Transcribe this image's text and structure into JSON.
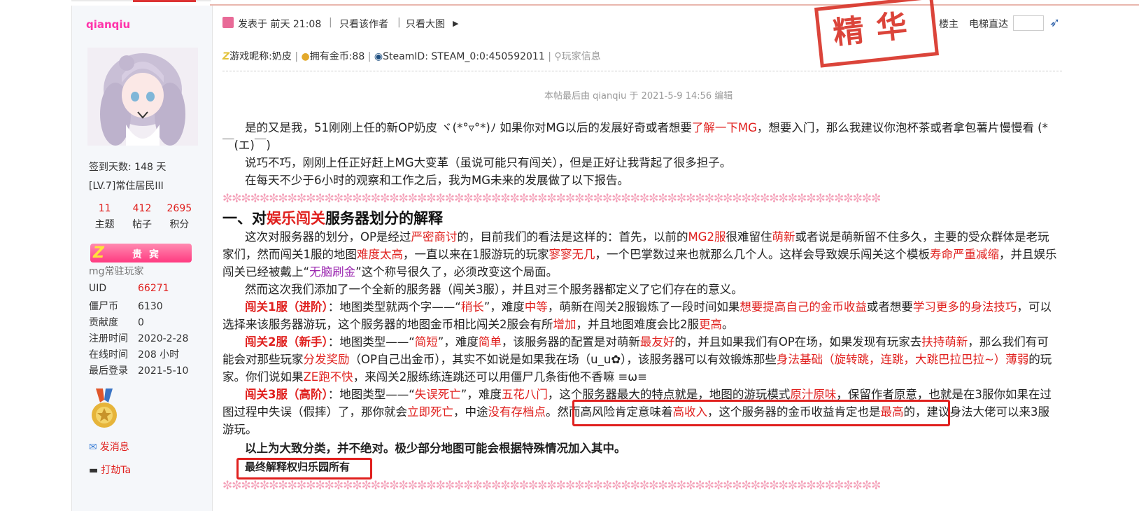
{
  "author": {
    "name": "qianqiu",
    "checkin": "签到天数: 148 天",
    "level": "[LV.7]常住居民III",
    "stats": [
      {
        "value": "11",
        "label": "主题"
      },
      {
        "value": "412",
        "label": "帖子"
      },
      {
        "value": "2695",
        "label": "积分"
      }
    ],
    "vip_label": "贵宾",
    "group": "mg常驻玩家",
    "fields": [
      {
        "key": "UID",
        "value": "66271"
      },
      {
        "key": "僵尸币",
        "value": "6130"
      },
      {
        "key": "贡献度",
        "value": "0"
      },
      {
        "key": "注册时间",
        "value": "2020-2-28"
      },
      {
        "key": "在线时间",
        "value": "208 小时"
      },
      {
        "key": "最后登录",
        "value": "2021-5-10"
      }
    ],
    "send_message": "发消息",
    "rob": "打劫Ta"
  },
  "post_header": {
    "posted": "发表于 前天 21:08",
    "only_author": "只看该作者",
    "big_image": "只看大图",
    "floor": "楼主",
    "elevator": "电梯直达",
    "stamp": "精华"
  },
  "player_info": {
    "nickname": "游戏昵称:奶皮",
    "coins": "拥有金币:88",
    "steam": "SteamID: STEAM_0:0:450592011",
    "player_info": "玩家信息"
  },
  "edited": "本帖最后由 qianqiu 于 2021-5-9 14:56 编辑",
  "intro": {
    "p1a": "是的又是我，51刚刚上任的新OP奶皮 ヾ(*°▿°*)ﾉ 如果你对MG以后的发展好奇或者想要",
    "p1b": "了解一下MG",
    "p1c": "，想要入门，那么我建议你泡杯茶或者拿包薯片慢慢看 (*￣(エ)￣)",
    "p2": "说巧不巧，刚刚上任正好赶上MG大变革（虽说可能只有闯关），但是正好让我背起了很多担子。",
    "p3": "在每天不少于6小时的观察和工作之后，我为MG未来的发展做了以下报告。"
  },
  "stars": "✼✼✼✼✼✼✼✼✼✼✼✼✼✼✼✼✼✼✼✼✼✼✼✼✼✼✼✼✼✼✼✼✼✼✼✼✼✼✼✼✼✼✼✼✼✼✼✼✼✼✼✼✼✼✼✼✼✼✼✼✼✼✼✼✼✼✼✼✼✼✼",
  "heading": {
    "a": "一、对",
    "b": "娱乐闯关",
    "c": "服务器划分的解释"
  },
  "para1": {
    "t1": "这次对服务器的划分，OP是经过",
    "r1": "严密商讨",
    "t2": "的，目前我们的看法是这样的：首先，以前的",
    "r2": "MG2服",
    "t3": "很难留住",
    "r3": "萌新",
    "t4": "或者说是萌新留不住多久，主要的受众群体是老玩家们，然而闯关1服的地图",
    "r4": "难度太高",
    "t5": "，一直以来在1服游玩的玩家",
    "r5": "寥寥无几",
    "t6": "，一个巴掌数过来也就那么几个人。这样会导致娱乐闯关这个模板",
    "r6": "寿命严重减缩",
    "t7": "，并且娱乐闯关已经被戴上“",
    "p1": "无脑刷金",
    "t8": "”这个称号很久了，必须改变这个局面。"
  },
  "para2": "然而这次我们添加了一个全新的服务器（闯关3服），并且对三个服务器都定义了它们存在的意义。",
  "s1": {
    "title": "闯关1服（进阶）",
    "t1": "：地图类型就两个字——“",
    "r1": "稍长",
    "t2": "”，难度",
    "r2": "中等",
    "t3": "，萌新在闯关2服锻炼了一段时间如果",
    "r3": "想要提高自己的金币收益",
    "t4": "或者想要",
    "r4": "学习更多的身法技巧",
    "t5": "，可以选择来该服务器游玩，这个服务器的地图金币相比闯关2服会有所",
    "r5": "增加",
    "t6": "，并且地图难度会比2服",
    "r6": "更高",
    "t7": "。"
  },
  "s2": {
    "title": "闯关2服（新手）",
    "t1": "：地图类型——“",
    "r1": "简短",
    "t2": "”，难度",
    "r2": "简单",
    "t3": "，该服务器的配置是对萌新",
    "r3": "最友好",
    "t4": "的，并且如果我们有OP在场，如果发现有玩家去",
    "r4": "扶持萌新",
    "t5": "，那么我们有可能会对那些玩家",
    "r5": "分发奖励",
    "t6": "（OP自己出金币），其实不如说是如果我在场（u_u✿），该服务器可以有效锻炼那些",
    "r6": "身法基础（旋转跳，连跳，大跳巴拉巴拉~）薄弱",
    "t7": "的玩家。你们说如果",
    "r7": "ZE跑不快",
    "t8": "，来闯关2服练练连跳还可以用僵尸几条街他不香嘛 ≡ω≡"
  },
  "s3": {
    "title": "闯关3服（高阶）",
    "t1": "：地图类型——“",
    "r1": "失误死亡",
    "t2": "”，难度",
    "r2": "五花八门",
    "t3": "，这个服务器最大的特点就是，地图的游玩模式",
    "r3": "原汁原味",
    "t4": "，保留作者原意，也就是在3服你如果在过图过程中失误（假摔）了，那你就会",
    "r4": "立即死亡",
    "t5": "，中途",
    "r5": "没有存档点",
    "t6": "。然而高风险肯定意味着",
    "r6": "高收入",
    "t7": "，这个服务器的金币收益肯定也是",
    "r7": "最高",
    "t8": "的，建议身法大佬可以来3服游玩。"
  },
  "note": "以上为大致分类，并不绝对。极少部分地图可能会根据特殊情况加入其中。",
  "final": "最终解释权归乐园所有"
}
